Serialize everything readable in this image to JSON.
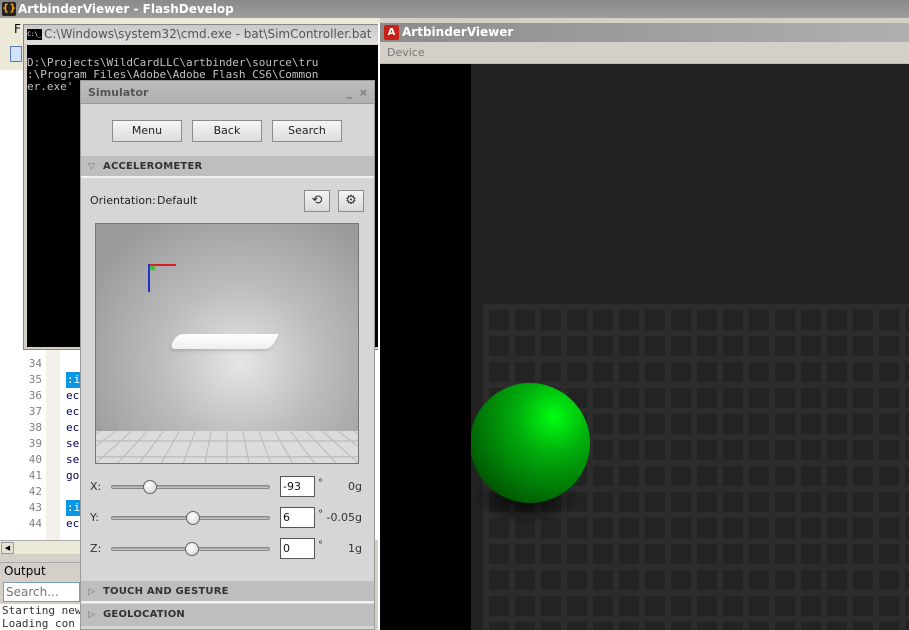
{
  "flashdevelop": {
    "title": "ArtbinderViewer - FlashDevelop",
    "icon": "flashdevelop-logo-icon",
    "menu_first": "F",
    "code_lines": [
      {
        "num": "34",
        "text": ""
      },
      {
        "num": "35",
        "text": ":i",
        "selected": true
      },
      {
        "num": "36",
        "text": "ec"
      },
      {
        "num": "37",
        "text": "ec"
      },
      {
        "num": "38",
        "text": "ec"
      },
      {
        "num": "39",
        "text": "se"
      },
      {
        "num": "40",
        "text": "se"
      },
      {
        "num": "41",
        "text": "go"
      },
      {
        "num": "42",
        "text": ""
      },
      {
        "num": "43",
        "text": ":i",
        "selected": true
      },
      {
        "num": "44",
        "text": "ec"
      }
    ],
    "output": {
      "tab_label": "Output",
      "search_placeholder": "Search...",
      "lines": [
        "Starting new",
        "Loading con"
      ]
    }
  },
  "cmd": {
    "title": "C:\\Windows\\system32\\cmd.exe - bat\\SimController.bat",
    "lines": [
      "D:\\Projects\\WildCardLLC\\artbinder\\source\\tru",
      ":\\Program Files\\Adobe\\Adobe Flash CS6\\Common",
      "er.exe'"
    ]
  },
  "simulator": {
    "title": "Simulator",
    "minimize": "_",
    "close": "×",
    "buttons": {
      "menu": "Menu",
      "back": "Back",
      "search": "Search"
    },
    "accelerometer": {
      "header": "ACCELEROMETER",
      "expanded": true,
      "orientation_label": "Orientation:",
      "orientation_value": "Default",
      "axes": [
        {
          "label": "X:",
          "angle": "-93",
          "unit": "°",
          "g": "0g",
          "slider_fraction": 0.24
        },
        {
          "label": "Y:",
          "angle": "6",
          "unit": "°",
          "g": "-0.05g",
          "slider_fraction": 0.51
        },
        {
          "label": "Z:",
          "angle": "0",
          "unit": "°",
          "g": "1g",
          "slider_fraction": 0.5
        }
      ]
    },
    "sections": [
      {
        "header": "TOUCH AND GESTURE",
        "expanded": false
      },
      {
        "header": "GEOLOCATION",
        "expanded": false
      }
    ]
  },
  "artbinder": {
    "title": "ArtbinderViewer",
    "icon": "adobe-air-icon",
    "menu": [
      "Device"
    ],
    "ball_color": "#00c00c"
  }
}
